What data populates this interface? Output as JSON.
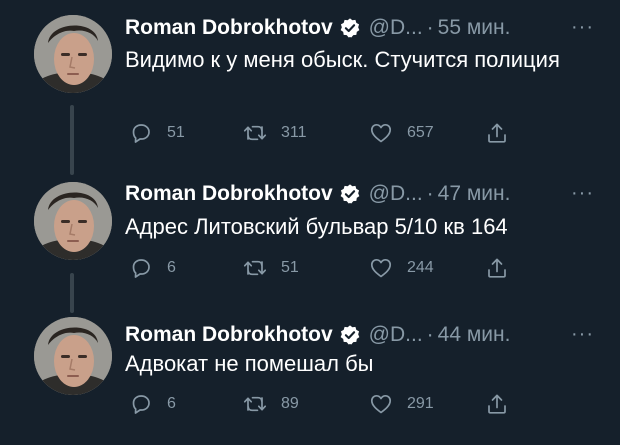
{
  "colors": {
    "background": "#15202b",
    "primary_text": "#ffffff",
    "secondary_text": "#8899a6",
    "verified_badge": "#ffffff",
    "thread_line": "#38444d"
  },
  "icons": {
    "verified": "verified-badge-icon",
    "more": "more-options-icon",
    "reply": "reply-icon",
    "retweet": "retweet-icon",
    "like": "heart-icon",
    "share": "share-icon"
  },
  "tweets": [
    {
      "author_name": "Roman Dobrokhotov",
      "handle": "@D...",
      "separator": "·",
      "time": "55 мин.",
      "more": "···",
      "text": "Видимо к у меня обыск. Стучится полиция",
      "replies": "51",
      "retweets": "311",
      "likes": "657"
    },
    {
      "author_name": "Roman Dobrokhotov",
      "handle": "@D...",
      "separator": "·",
      "time": "47 мин.",
      "more": "···",
      "text": "Адрес Литовский бульвар 5/10 кв 164",
      "replies": "6",
      "retweets": "51",
      "likes": "244"
    },
    {
      "author_name": "Roman Dobrokhotov",
      "handle": "@D...",
      "separator": "·",
      "time": "44 мин.",
      "more": "···",
      "text": "Адвокат не помешал бы",
      "replies": "6",
      "retweets": "89",
      "likes": "291"
    }
  ]
}
